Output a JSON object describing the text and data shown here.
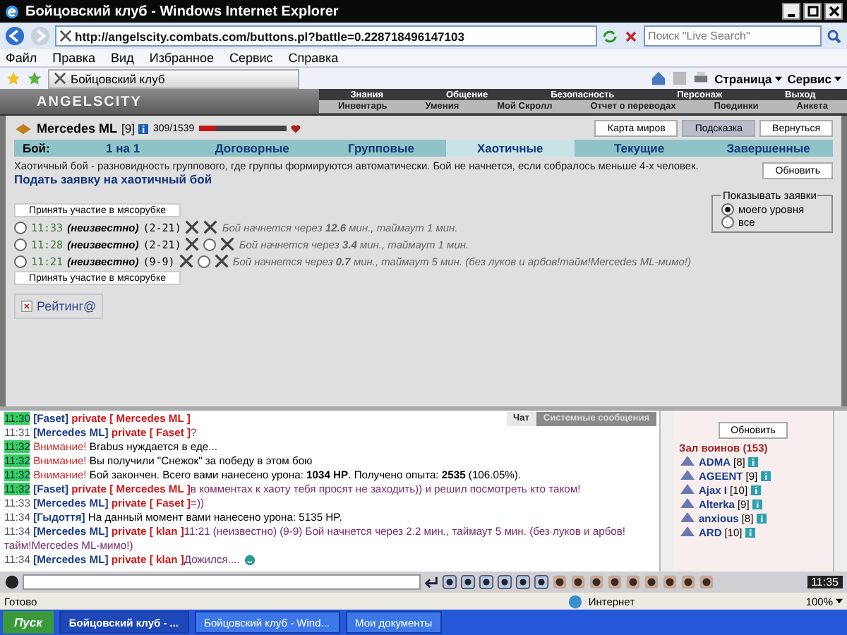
{
  "window": {
    "title": "Бойцовский клуб - Windows Internet Explorer"
  },
  "address": {
    "url": "http://angelscity.combats.com/buttons.pl?battle=0.228718496147103"
  },
  "search": {
    "placeholder": "Поиск \"Live Search\""
  },
  "menu": [
    "Файл",
    "Правка",
    "Вид",
    "Избранное",
    "Сервис",
    "Справка"
  ],
  "browser_tab": {
    "label": "Бойцовский клуб"
  },
  "commands": [
    "Страница",
    "Сервис"
  ],
  "game_header": {
    "logo": "ANGELSCITY",
    "nav_top": [
      "Знания",
      "Общение",
      "Безопасность",
      "Персонаж",
      "Выход"
    ],
    "nav_bottom": [
      "Инвентарь",
      "Умения",
      "Мой Скролл",
      "Отчет о переводах",
      "Поединки",
      "Анкета"
    ]
  },
  "player": {
    "name": "Mercedes ML",
    "rank": "[9]",
    "hp": "309/1539",
    "level": 0.2
  },
  "top_buttons": [
    {
      "label": "Карта миров",
      "selected": false
    },
    {
      "label": "Подсказка",
      "selected": true
    },
    {
      "label": "Вернуться",
      "selected": false
    }
  ],
  "battle_tabs_label": "Бой:",
  "battle_tabs": [
    {
      "label": "1 на 1",
      "selected": false
    },
    {
      "label": "Договорные",
      "selected": false
    },
    {
      "label": "Групповые",
      "selected": false
    },
    {
      "label": "Хаотичные",
      "selected": true
    },
    {
      "label": "Текущие",
      "selected": false
    },
    {
      "label": "Завершенные",
      "selected": false
    }
  ],
  "description": "Хаотичный бой - разновидность группового, где группы формируются автоматически. Бой не начнется, если собралось меньше 4-х человек.",
  "refresh_button": "Обновить",
  "request_link": "Подать заявку на хаотичный бой",
  "join_buttons": [
    "Принять участие в мясорубке",
    "Принять участие в мясорубке"
  ],
  "requests": [
    {
      "time": "11:33",
      "who": "(неизвестно)",
      "range": "(2-21)",
      "second_radio": false,
      "selected": false,
      "text": "Бой начнется через **12.6** мин., таймаут 1 мин."
    },
    {
      "time": "11:28",
      "who": "(неизвестно)",
      "range": "(2-21)",
      "second_radio": true,
      "selected": false,
      "text": "Бой начнется через **3.4** мин., таймаут 1 мин."
    },
    {
      "time": "11:21",
      "who": "(неизвестно)",
      "range": "(9-9)",
      "second_radio": true,
      "selected": false,
      "text": "Бой начнется через **0.7** мин., таймаут 5 мин. (без луков и арбов!тайм!Mercedes ML-мимо!)"
    }
  ],
  "filter": {
    "title": "Показывать заявки",
    "options": [
      {
        "label": "моего уровня",
        "selected": true
      },
      {
        "label": "все",
        "selected": false
      }
    ]
  },
  "rating": "Рейтинг@",
  "chat_tabs": [
    {
      "label": "Чат",
      "selected": true
    },
    {
      "label": "Системные сообщения",
      "selected": false
    }
  ],
  "chat": [
    {
      "time": "11:30",
      "new": true,
      "kind": "private",
      "sender": "[Faset]",
      "target": "private [ Mercedes ML ]"
    },
    {
      "time": "11:31",
      "new": false,
      "kind": "private",
      "sender": "[Mercedes ML]",
      "target": "private [ Faset ]",
      "text": "?"
    },
    {
      "time": "11:32",
      "new": true,
      "kind": "system",
      "label": "Внимание!",
      "text": "Brabus нуждается в еде..."
    },
    {
      "time": "11:32",
      "new": true,
      "kind": "system",
      "label": "Внимание!",
      "text": "Вы получили \"Снежок\" за победу в этом бою"
    },
    {
      "time": "11:32",
      "new": true,
      "kind": "system",
      "label": "Внимание!",
      "text": "Бой закончен. Всего вами нанесено урона: **1034 HP**. Получено опыта: **2535** (106.05%)."
    },
    {
      "time": "11:32",
      "new": true,
      "kind": "private",
      "sender": "[Faset]",
      "target": "private [ Mercedes ML ]",
      "text": "в комментах к хаоту тебя просят не заходить)) и решил посмотреть кто таком!"
    },
    {
      "time": "11:33",
      "new": false,
      "kind": "private",
      "sender": "[Mercedes ML]",
      "target": "private [ Faset ]",
      "text": "=))"
    },
    {
      "time": "11:34",
      "new": false,
      "kind": "plain",
      "sender": "[Гыдоття]",
      "text": "На данный момент вами нанесено урона: 5135 HP."
    },
    {
      "time": "11:34",
      "new": false,
      "kind": "private",
      "sender": "[Mercedes ML]",
      "target": "private [ klan ]",
      "text": "11:21 (неизвестно) (9-9) Бой начнется через 2.2 мин., таймаут 5 мин. (без луков и арбов!тайм!Mercedes ML-мимо!)"
    },
    {
      "time": "11:34",
      "new": false,
      "kind": "private",
      "sender": "[Mercedes ML]",
      "target": "private [ klan ]",
      "text": "Дожился....",
      "smiley": true
    }
  ],
  "online": {
    "button": "Обновить",
    "title": "Зал воинов (153)",
    "users": [
      {
        "name": "ADMA",
        "rank": "[8]"
      },
      {
        "name": "AGEENT",
        "rank": "[9]"
      },
      {
        "name": "Ajax I",
        "rank": "[10]"
      },
      {
        "name": "Alterka",
        "rank": "[9]"
      },
      {
        "name": "anxious",
        "rank": "[8]"
      },
      {
        "name": "ARD",
        "rank": "[10]"
      }
    ]
  },
  "clock": "11:35",
  "status_bar": {
    "text": "Готово",
    "zone": "Интернет",
    "zoom": "100%"
  },
  "taskbar": {
    "start": "Пуск",
    "tasks": [
      {
        "label": "Бойцовский клуб - ...",
        "selected": true
      },
      {
        "label": "Бойцовский клуб - Wind...",
        "selected": false
      },
      {
        "label": "Мои документы",
        "selected": false
      }
    ]
  }
}
